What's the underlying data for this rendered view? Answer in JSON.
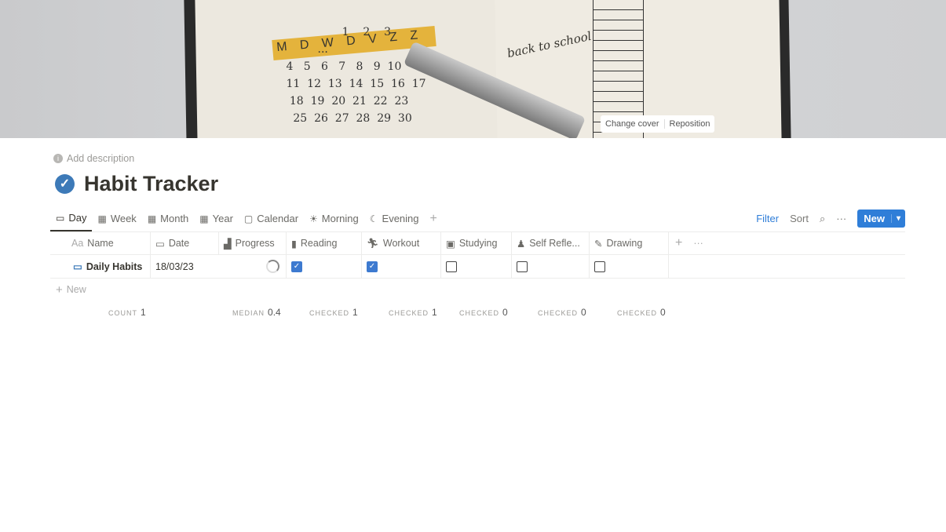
{
  "cover": {
    "change_label": "Change cover",
    "reposition_label": "Reposition",
    "calendar_header": "M D W D V Z Z",
    "note": "back to school"
  },
  "page": {
    "add_description": "Add description",
    "title": "Habit Tracker"
  },
  "tabs": [
    {
      "label": "Day",
      "icon": "calendar-icon",
      "active": true
    },
    {
      "label": "Week",
      "icon": "table-icon"
    },
    {
      "label": "Month",
      "icon": "table-icon"
    },
    {
      "label": "Year",
      "icon": "table-icon"
    },
    {
      "label": "Calendar",
      "icon": "calendar-icon"
    },
    {
      "label": "Morning",
      "icon": "sun-icon"
    },
    {
      "label": "Evening",
      "icon": "moon-icon"
    }
  ],
  "toolbar": {
    "filter": "Filter",
    "sort": "Sort",
    "new": "New"
  },
  "columns": [
    {
      "label": "Name",
      "icon": "Aa"
    },
    {
      "label": "Date",
      "icon": "calendar-icon"
    },
    {
      "label": "Progress",
      "icon": "chart-icon"
    },
    {
      "label": "Reading",
      "icon": "book-icon"
    },
    {
      "label": "Workout",
      "icon": "running-icon"
    },
    {
      "label": "Studying",
      "icon": "book-icon"
    },
    {
      "label": "Self Refle...",
      "icon": "person-icon"
    },
    {
      "label": "Drawing",
      "icon": "pencil-icon"
    }
  ],
  "rows": [
    {
      "name": "Daily Habits",
      "date": "18/03/23",
      "progress": 0.4,
      "reading": true,
      "workout": true,
      "studying": false,
      "self_reflection": false,
      "drawing": false
    }
  ],
  "add_row": "New",
  "footer": [
    {
      "label": "COUNT",
      "value": "1"
    },
    {
      "label": "MEDIAN",
      "value": "0.4"
    },
    {
      "label": "CHECKED",
      "value": "1"
    },
    {
      "label": "CHECKED",
      "value": "1"
    },
    {
      "label": "CHECKED",
      "value": "0"
    },
    {
      "label": "CHECKED",
      "value": "0"
    },
    {
      "label": "CHECKED",
      "value": "0"
    }
  ]
}
